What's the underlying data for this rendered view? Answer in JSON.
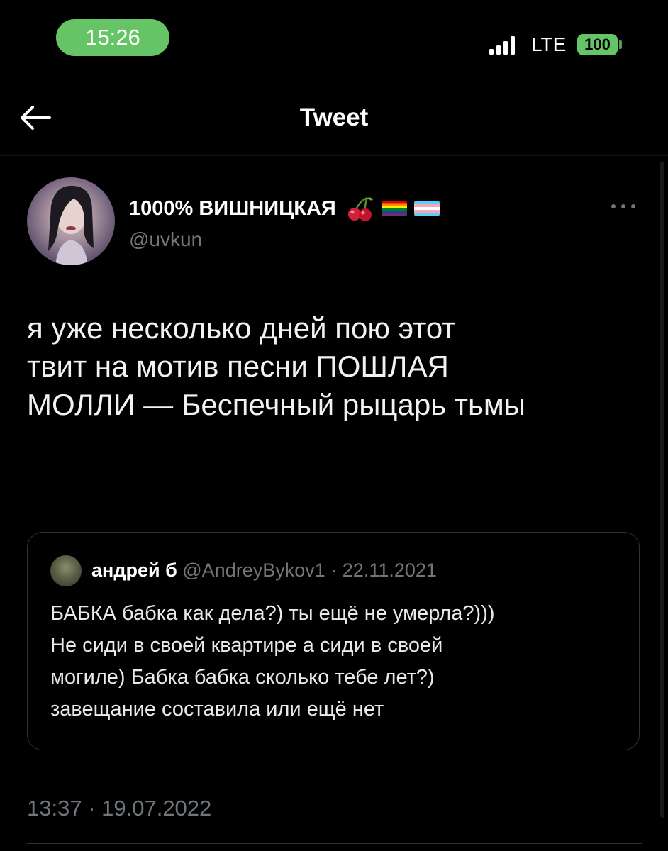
{
  "status_bar": {
    "time": "15:26",
    "network": "LTE",
    "battery": "100",
    "accent_color": "#65c466"
  },
  "header": {
    "back_icon": "arrow-left-icon",
    "title": "Tweet"
  },
  "tweet": {
    "author": {
      "display_name": "1000% ВИШНИЦКАЯ",
      "emoji": [
        "cherry",
        "rainbow-flag",
        "transgender-flag"
      ],
      "handle": "@uvkun"
    },
    "more_icon": "more-horizontal-icon",
    "text_lines": [
      "я уже несколько дней пою этот",
      "твит на мотив песни ПОШЛАЯ",
      "МОЛЛИ — Беспечный рыцарь тьмы"
    ],
    "quote": {
      "name": "андрей б",
      "handle": "@AndreyBykov1",
      "separator": "·",
      "date": "22.11.2021",
      "text_lines": [
        "БАБКА бабка как дела?) ты ещё не умерла?)))",
        "Не сиди в своей квартире а сиди в своей",
        "могиле) Бабка бабка сколько тебе лет?)",
        "завещание составила или ещё нет"
      ]
    },
    "timestamp": "13:37 · 19.07.2022"
  }
}
